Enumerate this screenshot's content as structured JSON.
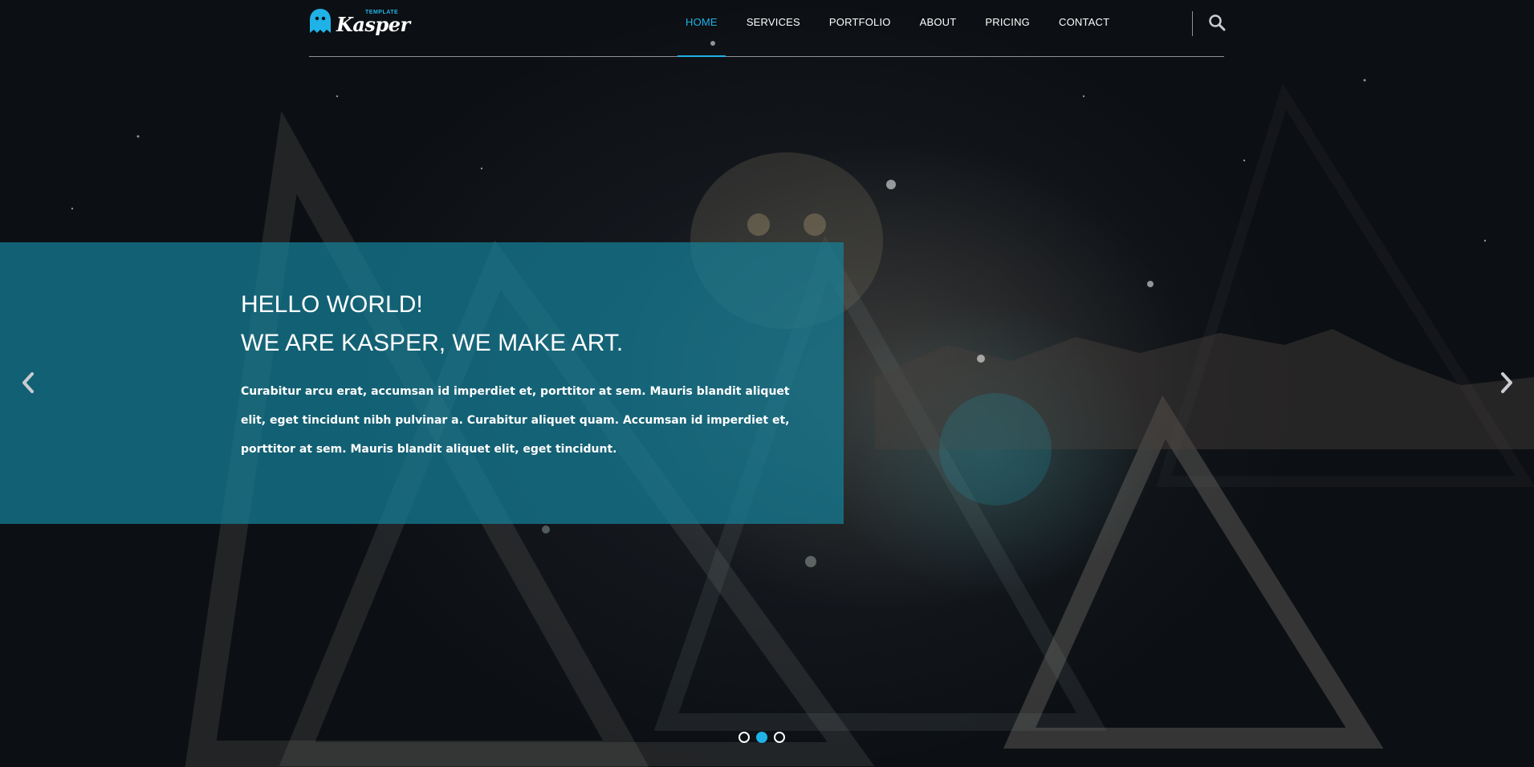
{
  "brand": {
    "name": "Kasper",
    "tagline": "TEMPLATE",
    "accent_color": "#1fb2e7",
    "logo_icon": "ghost-icon"
  },
  "nav": {
    "items": [
      {
        "label": "HOME",
        "active": true
      },
      {
        "label": "SERVICES",
        "active": false
      },
      {
        "label": "PORTFOLIO",
        "active": false
      },
      {
        "label": "ABOUT",
        "active": false
      },
      {
        "label": "PRICING",
        "active": false
      },
      {
        "label": "CONTACT",
        "active": false
      }
    ],
    "search_icon": "search-icon"
  },
  "slide": {
    "title_line1": "HELLO WORLD!",
    "title_line2": "WE ARE KASPER, WE MAKE ART.",
    "text": "Curabitur arcu erat, accumsan id imperdiet et, porttitor at sem. Mauris blandit aliquet elit, eget tincidunt nibh pulvinar a. Curabitur aliquet quam. Accumsan id imperdiet et, porttitor at sem. Mauris blandit aliquet elit, eget tincidunt.",
    "box_color": "#158099",
    "prev_icon": "chevron-left-icon",
    "next_icon": "chevron-right-icon"
  },
  "slider": {
    "dot_count": 3,
    "active_index": 1
  }
}
